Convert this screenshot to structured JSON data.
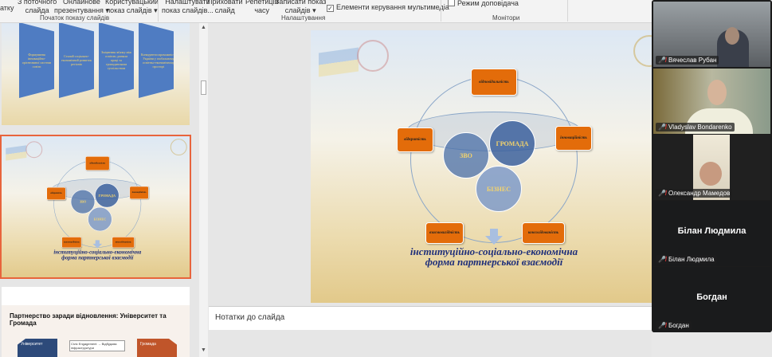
{
  "ribbon": {
    "buttons": [
      {
        "label": "атку"
      },
      {
        "label": "З поточного\nслайда"
      },
      {
        "label": "Онлайнове\nпрезентування ▾"
      },
      {
        "label": "Користувацький\nпоказ слайдів ▾"
      },
      {
        "label": "Налаштувати\nпоказ слайдів..."
      },
      {
        "label": "Приховати\nслайд"
      },
      {
        "label": "Репетиція\nчасу"
      },
      {
        "label": "Записати показ\nслайдів ▾"
      }
    ],
    "media_controls": {
      "label": "Елементи керування мультимедіа",
      "checked": true
    },
    "presenter_mode": {
      "label": "Режим доповідача",
      "checked": false
    },
    "groups": [
      "Початок показу слайдів",
      "Налаштування",
      "Монітори"
    ]
  },
  "thumbnails": {
    "slide1_boxes": [
      "Формування інноваційно-орієнтованої системи освіти",
      "Сталий соціально-економічний розвиток регіонів",
      "Зміцнення зв'язку між освітою, ринком праці та громадянським суспільством",
      "Конкурентоспроможність України у глобальному освітньо-економічному просторі"
    ],
    "slide3_title": "Партнерство заради відновлення: Університет та Громада",
    "slide3_left": "Університет",
    "slide3_mid": "Civic Engagement → Відбудова інфраструктури",
    "slide3_right": "Громада"
  },
  "slide": {
    "boxes": {
      "top": "відповідальність",
      "left": "відкритість",
      "right": "інноваційність",
      "bottom_left": "взаємовигідність",
      "bottom_right": "консолідованість"
    },
    "circles": {
      "a": "ЗВО",
      "b": "ГРОМАДА",
      "c": "БІЗНЕС"
    },
    "title_line1": "інституційно-соціально-економічна",
    "title_line2": "форма партнерської взаємодії"
  },
  "notes": {
    "placeholder": "Нотатки до слайда"
  },
  "participants": [
    {
      "name": "Вячеслав Рубан",
      "video": true
    },
    {
      "name": "Vladyslav Bondarenko",
      "video": true
    },
    {
      "name": "Олександр Мамедов",
      "video": true
    },
    {
      "name": "Білан Людмила",
      "video": false
    },
    {
      "name": "Богдан",
      "video": false
    }
  ],
  "colors": {
    "accent": "#e36c0a",
    "selected": "#e8643c",
    "circle": "#4a6fa8"
  }
}
